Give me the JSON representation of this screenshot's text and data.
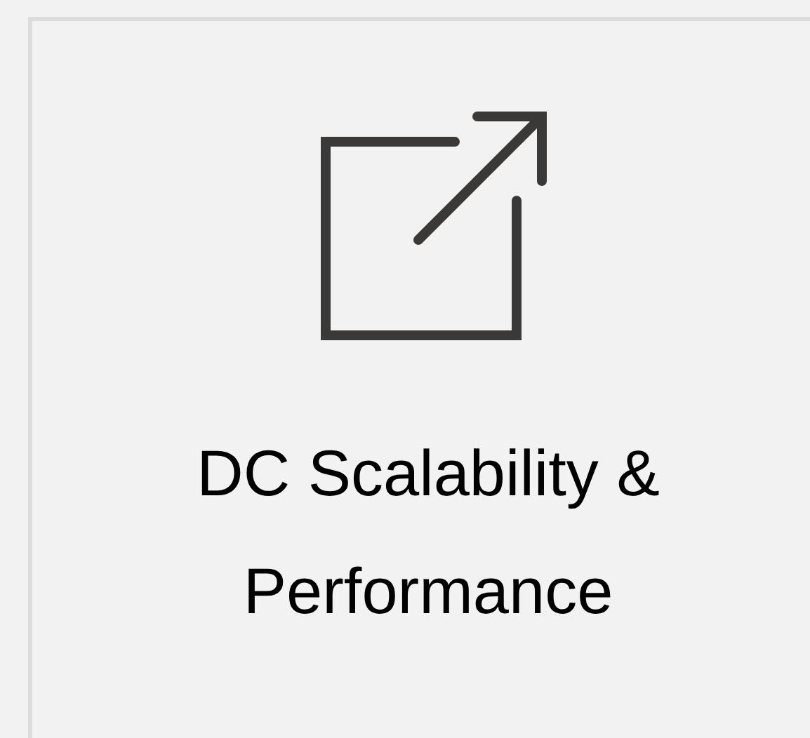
{
  "card": {
    "title_lines": [
      "DC Scalability &",
      "Performance"
    ]
  }
}
